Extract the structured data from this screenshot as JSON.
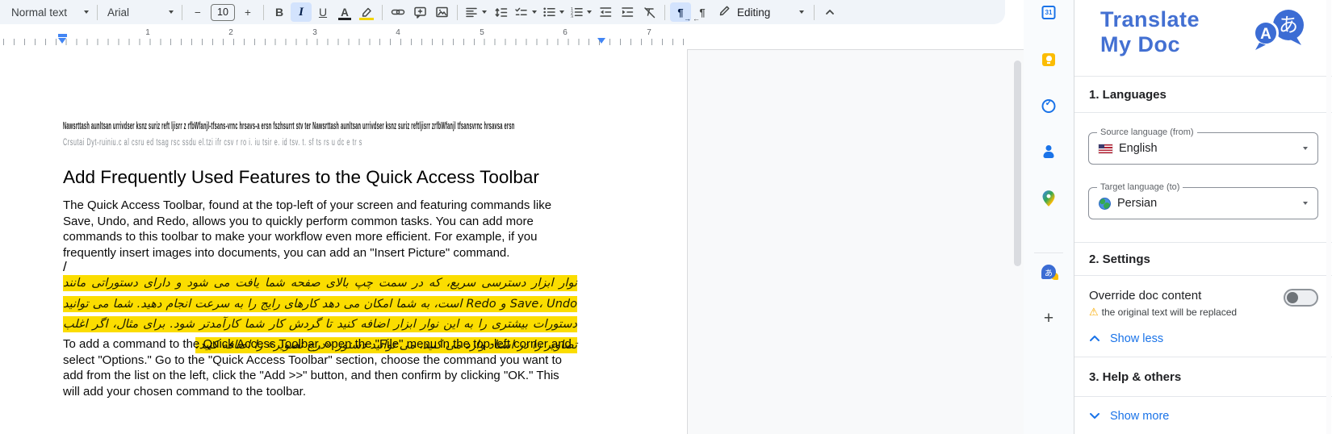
{
  "toolbar": {
    "style_selector": "Normal text",
    "font_selector": "Arial",
    "font_size": "10",
    "bold_label": "B",
    "italic_label": "I",
    "underline_label": "U",
    "text_color_label": "A",
    "pilcrow": "¶",
    "minus": "−",
    "plus": "+",
    "mode_label": "Editing",
    "collapse_glyph": "^"
  },
  "ruler": {
    "marks": [
      "1",
      "2",
      "3",
      "4",
      "5",
      "6",
      "7"
    ]
  },
  "document": {
    "garbled_line_1": "Nawsrttash aunltsan urrivdser ksnz suriz reft ljisrr z rfbWfanjl-tfsans-vrnc hrsavs-a ersn fszhsurrt stv ter Nawsrttash aunltsan urrivdser ksnz suriz reftljisrr zrfbWfanjl tfsansvrnc hrsavsa ersn",
    "garbled_line_2": "Crsutai Dyt-ruiniu.c al csru ed tsag rsc ssdu el.tzi ifr csv r ro i. iu tsir e. id tsv. t. sf ts rs u dc e tr s",
    "heading": "Add Frequently Used Features to the Quick Access Toolbar",
    "paragraph_1": "The Quick Access Toolbar, found at the top-left of your screen and featuring commands like Save, Undo, and Redo, allows you to quickly perform common tasks. You can add more commands to this toolbar to make your workflow even more efficient. For example, if you frequently insert images into documents, you can add an \"Insert Picture\" command.",
    "cursor_mark": "/",
    "persian_highlighted": "نوار ابزار دسترسی سریع، که در سمت چپ بالای صفحه شما یافت می شود و دارای دستوراتی مانند Save، Undo و Redo است، به شما امکان می دهد کارهای رایج را به سرعت انجام دهید. شما می توانید دستورات بیشتری را به این نوار ابزار اضافه کنید تا گردش کار شما کارآمدتر شود. برای مثال، اگر اغلب تصاویر را در اسناد وارد می کنید، می توانید دستور «درج تصویر» را اضافه کنید.",
    "paragraph_2": "To add a command to the Quick Access Toolbar, open the \"File\" menu in the top-left corner and select \"Options.\" Go to the \"Quick Access Toolbar\" section, choose the command you want to add from the list on the left, click the \"Add >>\" button, and then confirm by clicking \"OK.\" This will add your chosen command to the toolbar."
  },
  "side_strip": {
    "calendar_day": "31",
    "translate_glyph": "あ",
    "plus_glyph": "+"
  },
  "panel": {
    "logo_line_1": "Translate",
    "logo_line_2": "My Doc",
    "logo_bubble_a": "A",
    "logo_bubble_hiragana": "あ",
    "languages": {
      "title": "1. Languages",
      "source_label": "Source language (from)",
      "source_value": "English",
      "target_label": "Target language (to)",
      "target_value": "Persian"
    },
    "settings": {
      "title": "2. Settings",
      "override_label": "Override doc content",
      "warning_icon": "⚠",
      "override_warning": "the original text will be replaced",
      "show_less": "Show less"
    },
    "help": {
      "title": "3. Help & others",
      "show_more": "Show more"
    }
  },
  "colors": {
    "accent_blue": "#1a73e8",
    "logo_blue": "#4370d2",
    "active_chip": "#d3e3fd",
    "highlight_yellow": "#fbdd00",
    "warning_yellow": "#f9ab00",
    "toolbar_bg": "#f0f4f9"
  }
}
